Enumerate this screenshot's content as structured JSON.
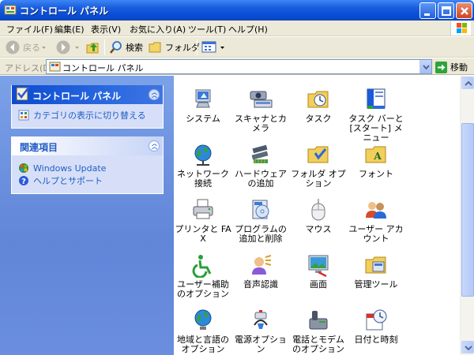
{
  "window": {
    "title": "コントロール パネル"
  },
  "menu": [
    "ファイル(F)",
    "編集(E)",
    "表示(V)",
    "お気に入り(A)",
    "ツール(T)",
    "ヘルプ(H)"
  ],
  "toolbar": {
    "back_label": "戻る",
    "search_label": "検索",
    "folders_label": "フォルダ"
  },
  "address": {
    "label": "アドレス(D)",
    "value": "コントロール パネル",
    "go_label": "移動"
  },
  "sidebar": {
    "panel1": {
      "title": "コントロール パネル",
      "link": "カテゴリの表示に切り替える"
    },
    "panel2": {
      "title": "関連項目",
      "links": [
        "Windows Update",
        "ヘルプとサポート"
      ]
    }
  },
  "items": [
    {
      "label": "システム",
      "icon": "system-icon"
    },
    {
      "label": "スキャナとカメラ",
      "icon": "scanner-camera-icon"
    },
    {
      "label": "タスク",
      "icon": "scheduled-tasks-icon"
    },
    {
      "label": "タスク バーと [スタート] メニュー",
      "icon": "taskbar-start-menu-icon"
    },
    {
      "label": "ネットワーク接続",
      "icon": "network-connections-icon"
    },
    {
      "label": "ハードウェアの追加",
      "icon": "add-hardware-icon"
    },
    {
      "label": "フォルダ オプション",
      "icon": "folder-options-icon"
    },
    {
      "label": "フォント",
      "icon": "fonts-folder-icon"
    },
    {
      "label": "プリンタと FAX",
      "icon": "printers-fax-icon"
    },
    {
      "label": "プログラムの追加と削除",
      "icon": "add-remove-programs-icon"
    },
    {
      "label": "マウス",
      "icon": "mouse-icon"
    },
    {
      "label": "ユーザー アカウント",
      "icon": "user-accounts-icon"
    },
    {
      "label": "ユーザー補助のオプション",
      "icon": "accessibility-icon"
    },
    {
      "label": "音声認識",
      "icon": "speech-icon"
    },
    {
      "label": "画面",
      "icon": "display-icon"
    },
    {
      "label": "管理ツール",
      "icon": "admin-tools-icon"
    },
    {
      "label": "地域と言語のオプション",
      "icon": "region-language-icon"
    },
    {
      "label": "電源オプション",
      "icon": "power-options-icon"
    },
    {
      "label": "電話とモデムのオプション",
      "icon": "phone-modem-icon"
    },
    {
      "label": "日付と時刻",
      "icon": "date-time-icon"
    }
  ]
}
